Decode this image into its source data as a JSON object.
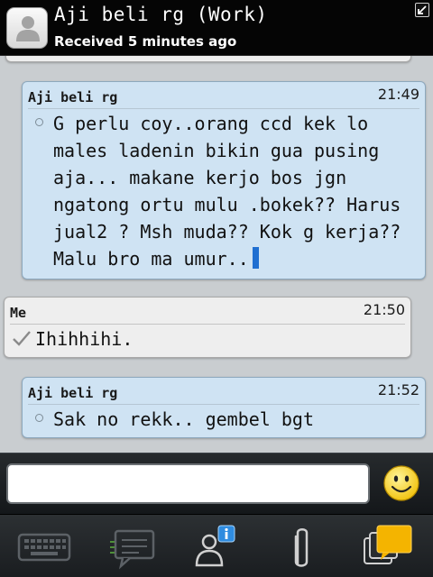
{
  "header": {
    "contact_name": "Aji beli rg (Work)",
    "status": "Received 5 minutes ago"
  },
  "messages": [
    {
      "sender": "Aji beli rg",
      "time": "21:49",
      "text": "G perlu coy..orang ccd kek lo males ladenin bikin gua pusing aja... makane kerjo bos jgn ngatong ortu mulu .bokek?? Harus jual2 ? Msh muda?? Kok g kerja?? Malu bro ma umur.."
    },
    {
      "sender": "Me",
      "time": "21:50",
      "text": "Ihihhihi."
    },
    {
      "sender": "Aji beli rg",
      "time": "21:52",
      "text": "Sak no rekk.. gembel bgt"
    }
  ],
  "composer": {
    "value": "",
    "placeholder": ""
  },
  "icons": {
    "avatar": "person-silhouette-icon",
    "resize": "collapse-arrow-icon",
    "smiley": "smiley-face-icon",
    "keyboard": "keyboard-icon",
    "chats": "chat-bubble-icon",
    "contact_info": "contact-info-icon",
    "attach": "paperclip-icon",
    "switch_chat": "switch-chats-icon"
  },
  "colors": {
    "incoming_bubble": "#cfe3f3",
    "outgoing_bubble": "#eeeeee",
    "cursor": "#1f6fd1",
    "smiley": "#f6cf1e",
    "active_chat": "#f4b400"
  }
}
